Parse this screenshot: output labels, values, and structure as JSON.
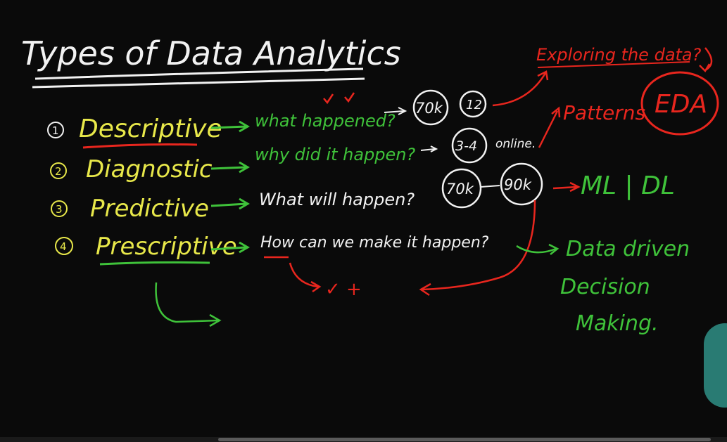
{
  "colors": {
    "board": "#0a0a0a",
    "chalk_white": "#f2f2f2",
    "yellow": "#e8e84a",
    "green": "#3fc23a",
    "red": "#e8261e"
  },
  "title": "Types of Data Analytics",
  "types": [
    {
      "num": "1",
      "name": "Descriptive",
      "question": "what happened?"
    },
    {
      "num": "2",
      "name": "Diagnostic",
      "question": "why did it happen?"
    },
    {
      "num": "3",
      "name": "Predictive",
      "question": "What will happen?"
    },
    {
      "num": "4",
      "name": "Prescriptive",
      "question": "How can we make it happen?"
    }
  ],
  "notes": {
    "n70k": "70k",
    "n12": "12",
    "n3_4": "3-4",
    "online": "online.",
    "n70k_b": "70k",
    "n90k": "90k",
    "exploring": "Exploring the data?",
    "patterns": "Patterns",
    "eda": "EDA",
    "ml_dl": "ML | DL",
    "data_driven": "Data driven",
    "decision": "Decision",
    "making": "Making.",
    "plus": "✓ +"
  }
}
